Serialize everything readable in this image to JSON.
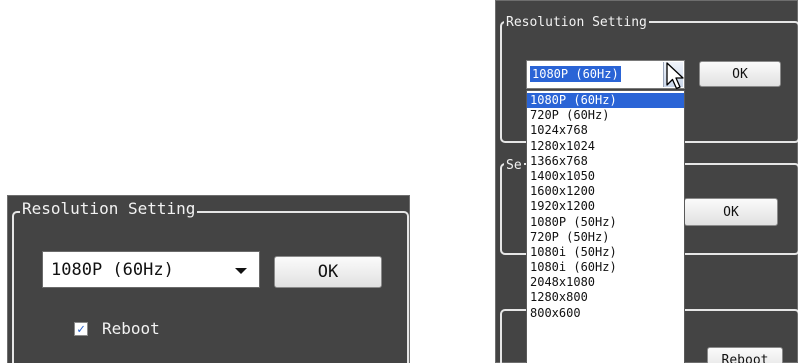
{
  "left_dialog": {
    "group_title": "Resolution Setting",
    "resolution_value": "1080P (60Hz)",
    "ok_label": "OK",
    "reboot_label": "Reboot",
    "reboot_checked": true
  },
  "right_dialog": {
    "group_title": "Resolution Setting",
    "second_group_title_fragment": "Se",
    "resolution_value": "1080P (60Hz)",
    "ok_label": "OK",
    "ok2_label": "OK",
    "reboot_label": "Reboot",
    "dropdown_open": true,
    "selected_index": 0,
    "options": [
      "1080P (60Hz)",
      "720P (60Hz)",
      "1024x768",
      "1280x1024",
      "1366x768",
      "1400x1050",
      "1600x1200",
      "1920x1200",
      "1080P (50Hz)",
      "720P (50Hz)",
      "1080i (50Hz)",
      "1080i (60Hz)",
      "2048x1080",
      "1280x800",
      "800x600"
    ]
  },
  "colors": {
    "panel_bg": "#444444",
    "group_border": "#e6e6e6",
    "selection": "#2a64d6",
    "check_mark": "#2a62c9"
  },
  "icons": {
    "combo_arrow": "chevron-down-icon",
    "checkbox": "checkmark-icon",
    "pointer": "mouse-cursor-icon"
  }
}
